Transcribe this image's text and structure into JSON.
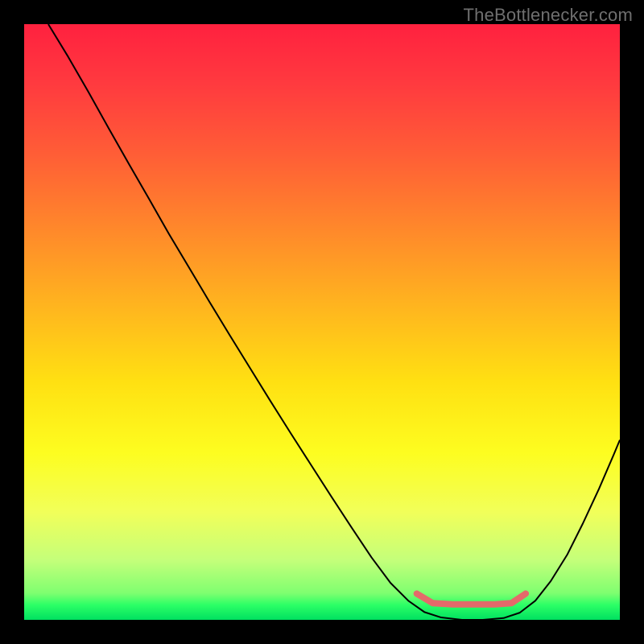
{
  "watermark": "TheBottlenecker.com",
  "chart_data": {
    "type": "line",
    "title": "",
    "xlabel": "",
    "ylabel": "",
    "xlim": [
      0,
      1
    ],
    "ylim": [
      0,
      1
    ],
    "plot_size": 740,
    "background_gradient": {
      "stops": [
        {
          "offset": 0.0,
          "color": "#ff213f"
        },
        {
          "offset": 0.1,
          "color": "#ff3a3f"
        },
        {
          "offset": 0.22,
          "color": "#ff5e36"
        },
        {
          "offset": 0.35,
          "color": "#ff8a2a"
        },
        {
          "offset": 0.48,
          "color": "#ffb71e"
        },
        {
          "offset": 0.6,
          "color": "#ffe012"
        },
        {
          "offset": 0.72,
          "color": "#fdfd20"
        },
        {
          "offset": 0.82,
          "color": "#f1ff5a"
        },
        {
          "offset": 0.9,
          "color": "#c4ff7a"
        },
        {
          "offset": 0.955,
          "color": "#7fff70"
        },
        {
          "offset": 0.975,
          "color": "#2cff66"
        },
        {
          "offset": 1.0,
          "color": "#00e060"
        }
      ]
    },
    "series": [
      {
        "name": "bottleneck-curve",
        "stroke": "#000000",
        "stroke_width": 2.0,
        "points": [
          {
            "x": 0.0405,
            "y": 1.0
          },
          {
            "x": 0.074,
            "y": 0.945
          },
          {
            "x": 0.108,
            "y": 0.886
          },
          {
            "x": 0.142,
            "y": 0.825
          },
          {
            "x": 0.176,
            "y": 0.765
          },
          {
            "x": 0.21,
            "y": 0.706
          },
          {
            "x": 0.243,
            "y": 0.648
          },
          {
            "x": 0.277,
            "y": 0.591
          },
          {
            "x": 0.311,
            "y": 0.534
          },
          {
            "x": 0.345,
            "y": 0.478
          },
          {
            "x": 0.379,
            "y": 0.423
          },
          {
            "x": 0.413,
            "y": 0.368
          },
          {
            "x": 0.447,
            "y": 0.314
          },
          {
            "x": 0.481,
            "y": 0.261
          },
          {
            "x": 0.515,
            "y": 0.208
          },
          {
            "x": 0.549,
            "y": 0.156
          },
          {
            "x": 0.583,
            "y": 0.105
          },
          {
            "x": 0.615,
            "y": 0.062
          },
          {
            "x": 0.645,
            "y": 0.032
          },
          {
            "x": 0.672,
            "y": 0.013
          },
          {
            "x": 0.7,
            "y": 0.004
          },
          {
            "x": 0.735,
            "y": 0.0
          },
          {
            "x": 0.77,
            "y": 0.0
          },
          {
            "x": 0.805,
            "y": 0.003
          },
          {
            "x": 0.832,
            "y": 0.012
          },
          {
            "x": 0.858,
            "y": 0.032
          },
          {
            "x": 0.884,
            "y": 0.065
          },
          {
            "x": 0.912,
            "y": 0.11
          },
          {
            "x": 0.938,
            "y": 0.162
          },
          {
            "x": 0.965,
            "y": 0.22
          },
          {
            "x": 0.99,
            "y": 0.278
          },
          {
            "x": 1.0,
            "y": 0.302
          }
        ]
      },
      {
        "name": "sweet-spot-band",
        "stroke": "#e46a6a",
        "stroke_width": 8,
        "linecap": "round",
        "points": [
          {
            "x": 0.659,
            "y": 0.044
          },
          {
            "x": 0.686,
            "y": 0.028
          },
          {
            "x": 0.72,
            "y": 0.026
          },
          {
            "x": 0.755,
            "y": 0.026
          },
          {
            "x": 0.79,
            "y": 0.026
          },
          {
            "x": 0.818,
            "y": 0.028
          },
          {
            "x": 0.842,
            "y": 0.044
          }
        ]
      }
    ]
  }
}
